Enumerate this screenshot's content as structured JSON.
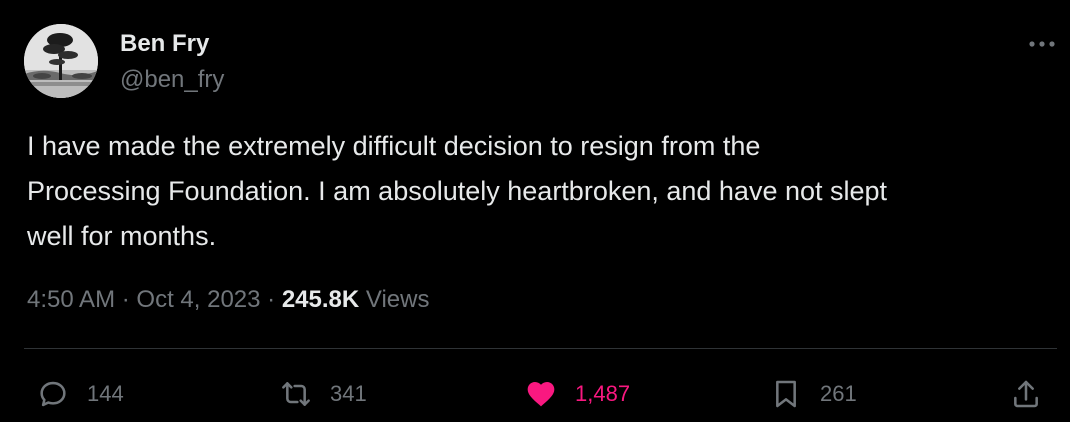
{
  "author": {
    "name": "Ben Fry",
    "handle": "@ben_fry"
  },
  "tweet": {
    "text": "I have made the extremely difficult decision to resign from the\nProcessing Foundation. I am absolutely heartbroken, and have not slept\nwell for months.",
    "time": "4:50 AM",
    "date": "Oct 4, 2023",
    "views_count": "245.8K",
    "views_label": "Views"
  },
  "actions": {
    "replies": "144",
    "reposts": "341",
    "likes": "1,487",
    "bookmarks": "261"
  },
  "colors": {
    "background": "#000000",
    "text": "#e7e9ea",
    "secondary": "#71767b",
    "like": "#f91880",
    "divider": "#2f3336"
  },
  "icons": [
    "more-icon",
    "reply-icon",
    "repost-icon",
    "like-icon",
    "bookmark-icon",
    "share-icon"
  ]
}
